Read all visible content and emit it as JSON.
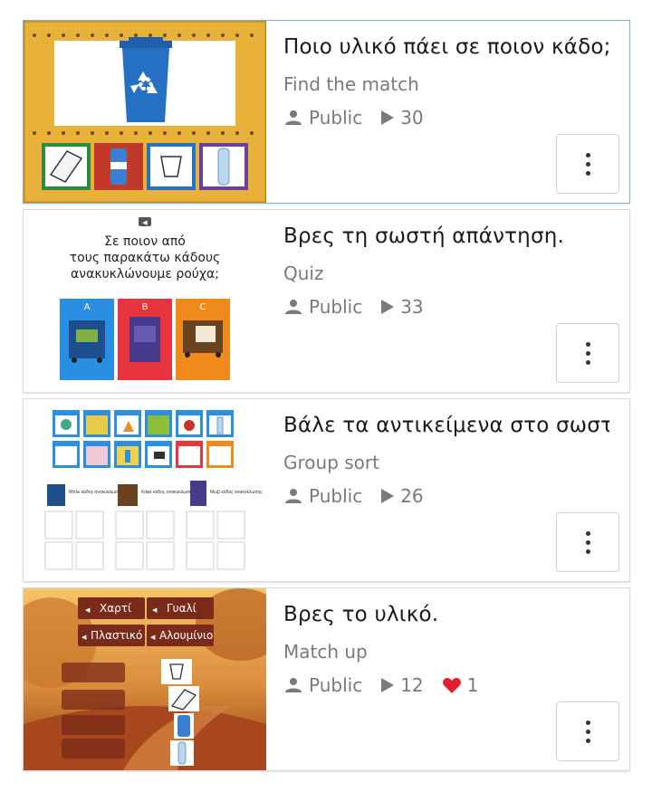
{
  "cards": [
    {
      "title": "Ποιο υλικό πάει σε ποιον κάδο;",
      "type": "Find the match",
      "visibility": "Public",
      "plays": "30",
      "likes": null,
      "icons": {
        "visibility": "person-icon",
        "plays": "play-icon",
        "menu": "more-vertical-icon"
      }
    },
    {
      "title": "Βρες τη σωστή απάντηση.",
      "type": "Quiz",
      "visibility": "Public",
      "plays": "33",
      "likes": null,
      "thumb": {
        "question": [
          "Σε ποιον από",
          "τους παρακάτω κάδους",
          "ανακυκλώνουμε ρούχα;"
        ],
        "options": [
          "A",
          "B",
          "C"
        ]
      }
    },
    {
      "title": "Βάλε τα αντικείμενα στο σωστό κάδο.",
      "type": "Group sort",
      "visibility": "Public",
      "plays": "26",
      "likes": null,
      "thumb": {
        "groups": [
          "Μπλε κάδος ανακύκλωσης",
          "Καφέ κάδος ανακύκλωσης",
          "Μωβ κάδος ανακύκλωσης"
        ]
      }
    },
    {
      "title": "Βρες το υλικό.",
      "type": "Match up",
      "visibility": "Public",
      "plays": "12",
      "likes": "1",
      "thumb": {
        "words": [
          "Χαρτί",
          "Γυαλί",
          "Πλαστικό",
          "Αλουμίνιο"
        ]
      }
    }
  ],
  "colors": {
    "heart": "#e0202e",
    "meta": "#7a7a7a",
    "title": "#1a1a1a"
  }
}
